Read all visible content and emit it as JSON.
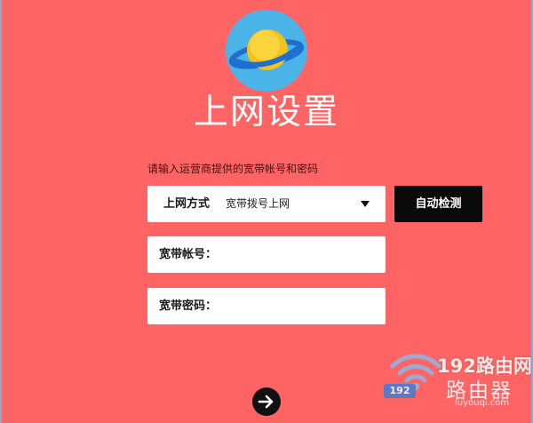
{
  "page": {
    "title": "上网设置",
    "hint": "请输入运营商提供的宽带帐号和密码"
  },
  "connection": {
    "label": "上网方式",
    "selected": "宽带拨号上网",
    "auto_detect_label": "自动检测"
  },
  "account": {
    "label": "宽带帐号：",
    "value": ""
  },
  "password": {
    "label": "宽带密码：",
    "value": ""
  },
  "watermark": {
    "badge": "192",
    "brand": "192路由网",
    "name": "路由器",
    "url": "luyouqi.com"
  },
  "colors": {
    "background": "#fe6464",
    "logo_circle": "#4ab3e8",
    "planet": "#f6c21a",
    "ring": "#1f6fd1",
    "button": "#0a0a0a"
  },
  "icons": {
    "logo": "planet-icon",
    "dropdown": "chevron-down-icon",
    "next": "arrow-right-icon",
    "watermark": "wifi-icon"
  }
}
